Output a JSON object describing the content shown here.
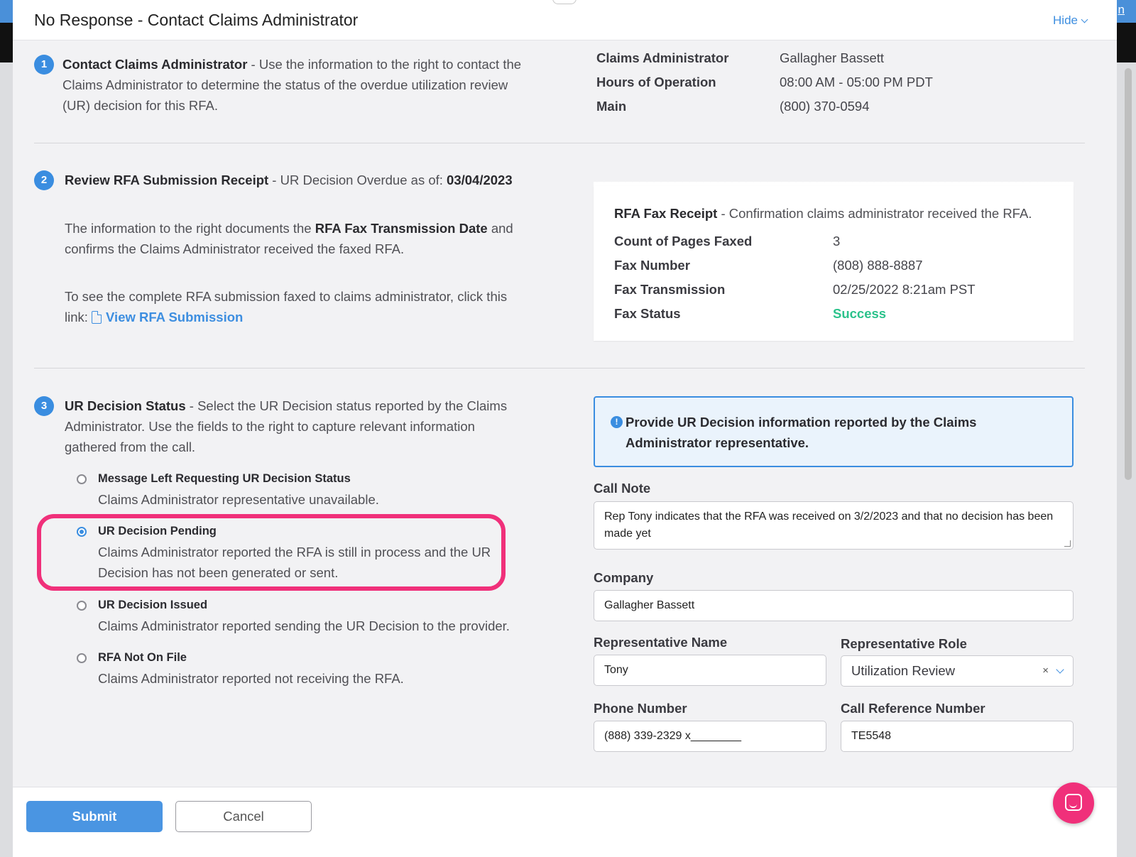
{
  "background": {
    "link_text": "n"
  },
  "modal": {
    "title": "No Response - Contact Claims Administrator",
    "hide_label": "Hide"
  },
  "step1": {
    "number": "1",
    "title": "Contact Claims Administrator",
    "text": " - Use the information to the right to contact the Claims Administrator to determine the status of the overdue utilization review (UR) decision for this RFA.",
    "info": [
      {
        "key": "Claims Administrator",
        "value": "Gallagher Bassett"
      },
      {
        "key": "Hours of Operation",
        "value": "08:00 AM - 05:00 PM PDT"
      },
      {
        "key": "Main",
        "value": "(800) 370-0594"
      }
    ]
  },
  "step2": {
    "number": "2",
    "title": "Review RFA Submission Receipt",
    "overdue_prefix": " - UR Decision Overdue as of: ",
    "overdue_date": "03/04/2023",
    "para1_a": "The information to the right documents the ",
    "para1_b": "RFA Fax Transmission Date",
    "para1_c": " and confirms the Claims Administrator received the faxed RFA.",
    "para2": "To see the complete RFA submission faxed to claims administrator, click this link: ",
    "link_label": "View RFA Submission",
    "receipt": {
      "title": "RFA Fax Receipt",
      "subtitle": " - Confirmation claims administrator received the RFA.",
      "rows": [
        {
          "key": "Count of Pages Faxed",
          "value": "3"
        },
        {
          "key": "Fax Number",
          "value": "(808) 888-8887"
        },
        {
          "key": "Fax Transmission",
          "value": "02/25/2022 8:21am PST"
        },
        {
          "key": "Fax Status",
          "value": "Success"
        }
      ],
      "success_color": "#2bc28b"
    }
  },
  "step3": {
    "number": "3",
    "title": "UR Decision Status",
    "text": " - Select the UR Decision status reported by the Claims Administrator. Use the fields to the right to capture relevant information gathered from the call.",
    "options": [
      {
        "title": "Message Left Requesting UR Decision Status",
        "desc": "Claims Administrator representative unavailable.",
        "checked": false
      },
      {
        "title": "UR Decision Pending",
        "desc": "Claims Administrator reported the RFA is still in process and the UR Decision has not been generated or sent.",
        "checked": true
      },
      {
        "title": "UR Decision Issued",
        "desc": "Claims Administrator reported sending the UR Decision to the provider.",
        "checked": false
      },
      {
        "title": "RFA Not On File",
        "desc": "Claims Administrator reported not receiving the RFA.",
        "checked": false
      }
    ],
    "highlight_color": "#f0307a"
  },
  "form": {
    "notice": "Provide UR Decision information reported by the Claims Administrator representative.",
    "notice_icon": "!",
    "call_note_label": "Call Note",
    "call_note_value": "Rep Tony indicates that the RFA was received on 3/2/2023 and that no decision has been made yet",
    "company_label": "Company",
    "company_value": "Gallagher Bassett",
    "rep_name_label": "Representative Name",
    "rep_name_value": "Tony",
    "rep_role_label": "Representative Role",
    "rep_role_value": "Utilization Review",
    "rep_role_clear": "×",
    "phone_label": "Phone Number",
    "phone_value": "(888) 339-2329 x________",
    "call_ref_label": "Call Reference Number",
    "call_ref_value": "TE5548"
  },
  "footer": {
    "submit_label": "Submit",
    "cancel_label": "Cancel"
  },
  "colors": {
    "accent": "#3a8de0",
    "highlight": "#f0307a"
  }
}
